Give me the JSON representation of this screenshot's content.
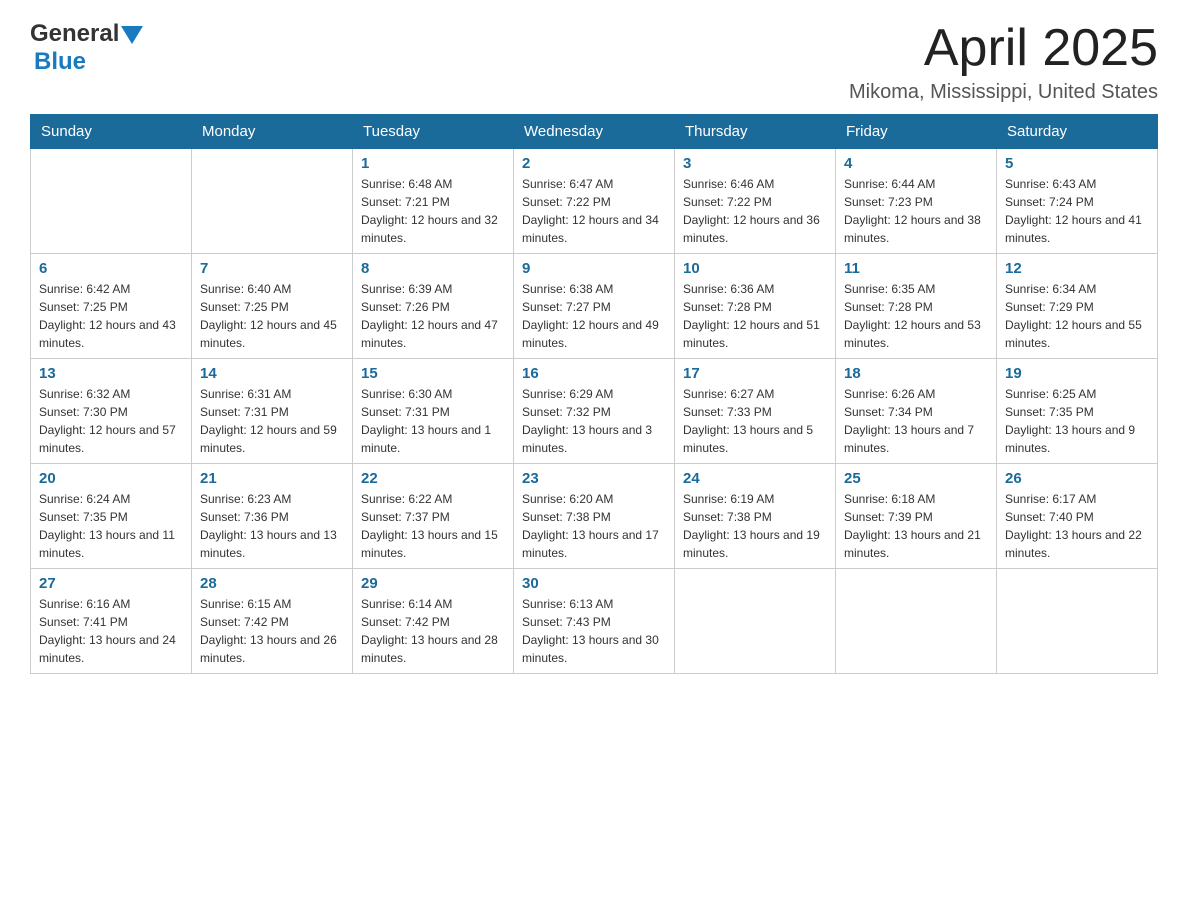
{
  "header": {
    "logo": {
      "text_general": "General",
      "text_blue": "Blue",
      "alt": "GeneralBlue logo"
    },
    "title": "April 2025",
    "location": "Mikoma, Mississippi, United States"
  },
  "days_of_week": [
    "Sunday",
    "Monday",
    "Tuesday",
    "Wednesday",
    "Thursday",
    "Friday",
    "Saturday"
  ],
  "weeks": [
    [
      {
        "day": "",
        "sunrise": "",
        "sunset": "",
        "daylight": ""
      },
      {
        "day": "",
        "sunrise": "",
        "sunset": "",
        "daylight": ""
      },
      {
        "day": "1",
        "sunrise": "Sunrise: 6:48 AM",
        "sunset": "Sunset: 7:21 PM",
        "daylight": "Daylight: 12 hours and 32 minutes."
      },
      {
        "day": "2",
        "sunrise": "Sunrise: 6:47 AM",
        "sunset": "Sunset: 7:22 PM",
        "daylight": "Daylight: 12 hours and 34 minutes."
      },
      {
        "day": "3",
        "sunrise": "Sunrise: 6:46 AM",
        "sunset": "Sunset: 7:22 PM",
        "daylight": "Daylight: 12 hours and 36 minutes."
      },
      {
        "day": "4",
        "sunrise": "Sunrise: 6:44 AM",
        "sunset": "Sunset: 7:23 PM",
        "daylight": "Daylight: 12 hours and 38 minutes."
      },
      {
        "day": "5",
        "sunrise": "Sunrise: 6:43 AM",
        "sunset": "Sunset: 7:24 PM",
        "daylight": "Daylight: 12 hours and 41 minutes."
      }
    ],
    [
      {
        "day": "6",
        "sunrise": "Sunrise: 6:42 AM",
        "sunset": "Sunset: 7:25 PM",
        "daylight": "Daylight: 12 hours and 43 minutes."
      },
      {
        "day": "7",
        "sunrise": "Sunrise: 6:40 AM",
        "sunset": "Sunset: 7:25 PM",
        "daylight": "Daylight: 12 hours and 45 minutes."
      },
      {
        "day": "8",
        "sunrise": "Sunrise: 6:39 AM",
        "sunset": "Sunset: 7:26 PM",
        "daylight": "Daylight: 12 hours and 47 minutes."
      },
      {
        "day": "9",
        "sunrise": "Sunrise: 6:38 AM",
        "sunset": "Sunset: 7:27 PM",
        "daylight": "Daylight: 12 hours and 49 minutes."
      },
      {
        "day": "10",
        "sunrise": "Sunrise: 6:36 AM",
        "sunset": "Sunset: 7:28 PM",
        "daylight": "Daylight: 12 hours and 51 minutes."
      },
      {
        "day": "11",
        "sunrise": "Sunrise: 6:35 AM",
        "sunset": "Sunset: 7:28 PM",
        "daylight": "Daylight: 12 hours and 53 minutes."
      },
      {
        "day": "12",
        "sunrise": "Sunrise: 6:34 AM",
        "sunset": "Sunset: 7:29 PM",
        "daylight": "Daylight: 12 hours and 55 minutes."
      }
    ],
    [
      {
        "day": "13",
        "sunrise": "Sunrise: 6:32 AM",
        "sunset": "Sunset: 7:30 PM",
        "daylight": "Daylight: 12 hours and 57 minutes."
      },
      {
        "day": "14",
        "sunrise": "Sunrise: 6:31 AM",
        "sunset": "Sunset: 7:31 PM",
        "daylight": "Daylight: 12 hours and 59 minutes."
      },
      {
        "day": "15",
        "sunrise": "Sunrise: 6:30 AM",
        "sunset": "Sunset: 7:31 PM",
        "daylight": "Daylight: 13 hours and 1 minute."
      },
      {
        "day": "16",
        "sunrise": "Sunrise: 6:29 AM",
        "sunset": "Sunset: 7:32 PM",
        "daylight": "Daylight: 13 hours and 3 minutes."
      },
      {
        "day": "17",
        "sunrise": "Sunrise: 6:27 AM",
        "sunset": "Sunset: 7:33 PM",
        "daylight": "Daylight: 13 hours and 5 minutes."
      },
      {
        "day": "18",
        "sunrise": "Sunrise: 6:26 AM",
        "sunset": "Sunset: 7:34 PM",
        "daylight": "Daylight: 13 hours and 7 minutes."
      },
      {
        "day": "19",
        "sunrise": "Sunrise: 6:25 AM",
        "sunset": "Sunset: 7:35 PM",
        "daylight": "Daylight: 13 hours and 9 minutes."
      }
    ],
    [
      {
        "day": "20",
        "sunrise": "Sunrise: 6:24 AM",
        "sunset": "Sunset: 7:35 PM",
        "daylight": "Daylight: 13 hours and 11 minutes."
      },
      {
        "day": "21",
        "sunrise": "Sunrise: 6:23 AM",
        "sunset": "Sunset: 7:36 PM",
        "daylight": "Daylight: 13 hours and 13 minutes."
      },
      {
        "day": "22",
        "sunrise": "Sunrise: 6:22 AM",
        "sunset": "Sunset: 7:37 PM",
        "daylight": "Daylight: 13 hours and 15 minutes."
      },
      {
        "day": "23",
        "sunrise": "Sunrise: 6:20 AM",
        "sunset": "Sunset: 7:38 PM",
        "daylight": "Daylight: 13 hours and 17 minutes."
      },
      {
        "day": "24",
        "sunrise": "Sunrise: 6:19 AM",
        "sunset": "Sunset: 7:38 PM",
        "daylight": "Daylight: 13 hours and 19 minutes."
      },
      {
        "day": "25",
        "sunrise": "Sunrise: 6:18 AM",
        "sunset": "Sunset: 7:39 PM",
        "daylight": "Daylight: 13 hours and 21 minutes."
      },
      {
        "day": "26",
        "sunrise": "Sunrise: 6:17 AM",
        "sunset": "Sunset: 7:40 PM",
        "daylight": "Daylight: 13 hours and 22 minutes."
      }
    ],
    [
      {
        "day": "27",
        "sunrise": "Sunrise: 6:16 AM",
        "sunset": "Sunset: 7:41 PM",
        "daylight": "Daylight: 13 hours and 24 minutes."
      },
      {
        "day": "28",
        "sunrise": "Sunrise: 6:15 AM",
        "sunset": "Sunset: 7:42 PM",
        "daylight": "Daylight: 13 hours and 26 minutes."
      },
      {
        "day": "29",
        "sunrise": "Sunrise: 6:14 AM",
        "sunset": "Sunset: 7:42 PM",
        "daylight": "Daylight: 13 hours and 28 minutes."
      },
      {
        "day": "30",
        "sunrise": "Sunrise: 6:13 AM",
        "sunset": "Sunset: 7:43 PM",
        "daylight": "Daylight: 13 hours and 30 minutes."
      },
      {
        "day": "",
        "sunrise": "",
        "sunset": "",
        "daylight": ""
      },
      {
        "day": "",
        "sunrise": "",
        "sunset": "",
        "daylight": ""
      },
      {
        "day": "",
        "sunrise": "",
        "sunset": "",
        "daylight": ""
      }
    ]
  ]
}
